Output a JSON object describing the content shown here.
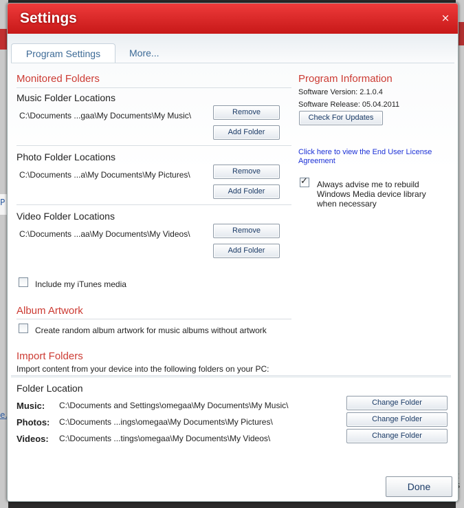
{
  "dialog": {
    "title": "Settings",
    "close_symbol": "×"
  },
  "tabs": [
    {
      "label": "Program Settings",
      "active": true
    },
    {
      "label": "More..."
    }
  ],
  "monitored": {
    "title": "Monitored Folders",
    "groups": [
      {
        "label": "Music Folder Locations",
        "path": "C:\\Documents ...gaa\\My Documents\\My Music\\",
        "remove": "Remove",
        "add": "Add Folder"
      },
      {
        "label": "Photo Folder Locations",
        "path": "C:\\Documents ...a\\My Documents\\My Pictures\\",
        "remove": "Remove",
        "add": "Add Folder"
      },
      {
        "label": "Video Folder Locations",
        "path": "C:\\Documents ...aa\\My Documents\\My Videos\\",
        "remove": "Remove",
        "add": "Add Folder"
      }
    ],
    "itunes_label": "Include my iTunes media",
    "itunes_checked": false
  },
  "album": {
    "title": "Album Artwork",
    "checkbox_label": "Create random album artwork for music albums without artwork",
    "checked": false
  },
  "program_info": {
    "title": "Program Information",
    "version": "Software Version: 2.1.0.4",
    "release": "Software Release: 05.04.2011",
    "check_updates": "Check For Updates",
    "eula_link": "Click here to view the End User License Agreement",
    "rebuild_label": "Always advise me to rebuild Windows Media device library when necessary",
    "rebuild_checked": true
  },
  "import": {
    "title": "Import Folders",
    "description": "Import content from your device into the following folders on your PC:",
    "folder_location": "Folder Location",
    "rows": [
      {
        "label": "Music:",
        "path": "C:\\Documents and Settings\\omegaa\\My Documents\\My Music\\",
        "button": "Change Folder"
      },
      {
        "label": "Photos:",
        "path": "C:\\Documents ...ings\\omegaa\\My Documents\\My Pictures\\",
        "button": "Change Folder"
      },
      {
        "label": "Videos:",
        "path": "C:\\Documents ...tings\\omegaa\\My Documents\\My Videos\\",
        "button": "Change Folder"
      }
    ]
  },
  "done_label": "Done",
  "background": {
    "left_glyph_1": "P",
    "left_glyph_2": "e.",
    "right_glyph": "t s"
  },
  "colors": {
    "title_red": "#d62a2a",
    "section_red": "#cc3b33",
    "tab_blue": "#3c6a96",
    "link_blue": "#1a2fd6"
  }
}
